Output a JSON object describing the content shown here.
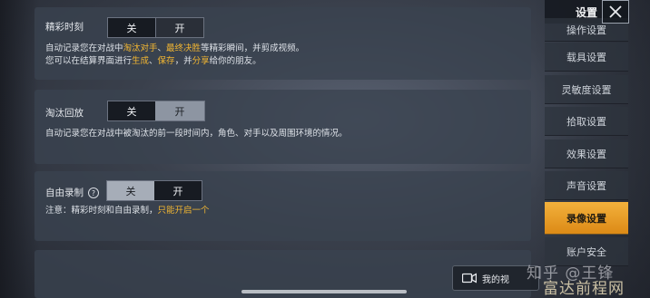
{
  "settings": {
    "highlights": {
      "label": "精彩时刻",
      "toggle_off": "关",
      "toggle_on": "开",
      "desc_line1_prefix": "自动记录您在对战中",
      "desc_line1_hl1": "淘汰对手",
      "desc_line1_sep": "、",
      "desc_line1_hl2": "最终决胜",
      "desc_line1_suffix": "等精彩瞬间，并剪成视频。",
      "desc_line2_prefix": "您可以在结算界面进行",
      "desc_line2_hl1": "生成",
      "desc_line2_sep": "、",
      "desc_line2_hl2": "保存",
      "desc_line2_mid": "，并",
      "desc_line2_hl3": "分享",
      "desc_line2_suffix": "给你的朋友。"
    },
    "elimination_replay": {
      "label": "淘汰回放",
      "toggle_off": "关",
      "toggle_on": "开",
      "desc": "自动记录您在对战中被淘汰的前一段时间内，角色、对手以及周围环境的情况。"
    },
    "free_recording": {
      "label": "自由录制",
      "toggle_off": "关",
      "toggle_on": "开",
      "help_glyph": "?",
      "note_prefix": "注意：精彩时刻和自由录制，",
      "note_hl": "只能开启一个"
    }
  },
  "sidebar": {
    "header": "设置",
    "items": [
      {
        "label": "操作设置"
      },
      {
        "label": "载具设置"
      },
      {
        "label": "灵敏度设置"
      },
      {
        "label": "拾取设置"
      },
      {
        "label": "效果设置"
      },
      {
        "label": "声音设置"
      },
      {
        "label": "录像设置"
      },
      {
        "label": "账户安全"
      }
    ],
    "active_index": 6
  },
  "video_button": {
    "label": "我的视"
  },
  "watermark": {
    "text1": "知乎 @王锋",
    "text2": "富达前程网"
  },
  "colors": {
    "accent": "#f2b632",
    "active_tab": "#e89a22"
  }
}
